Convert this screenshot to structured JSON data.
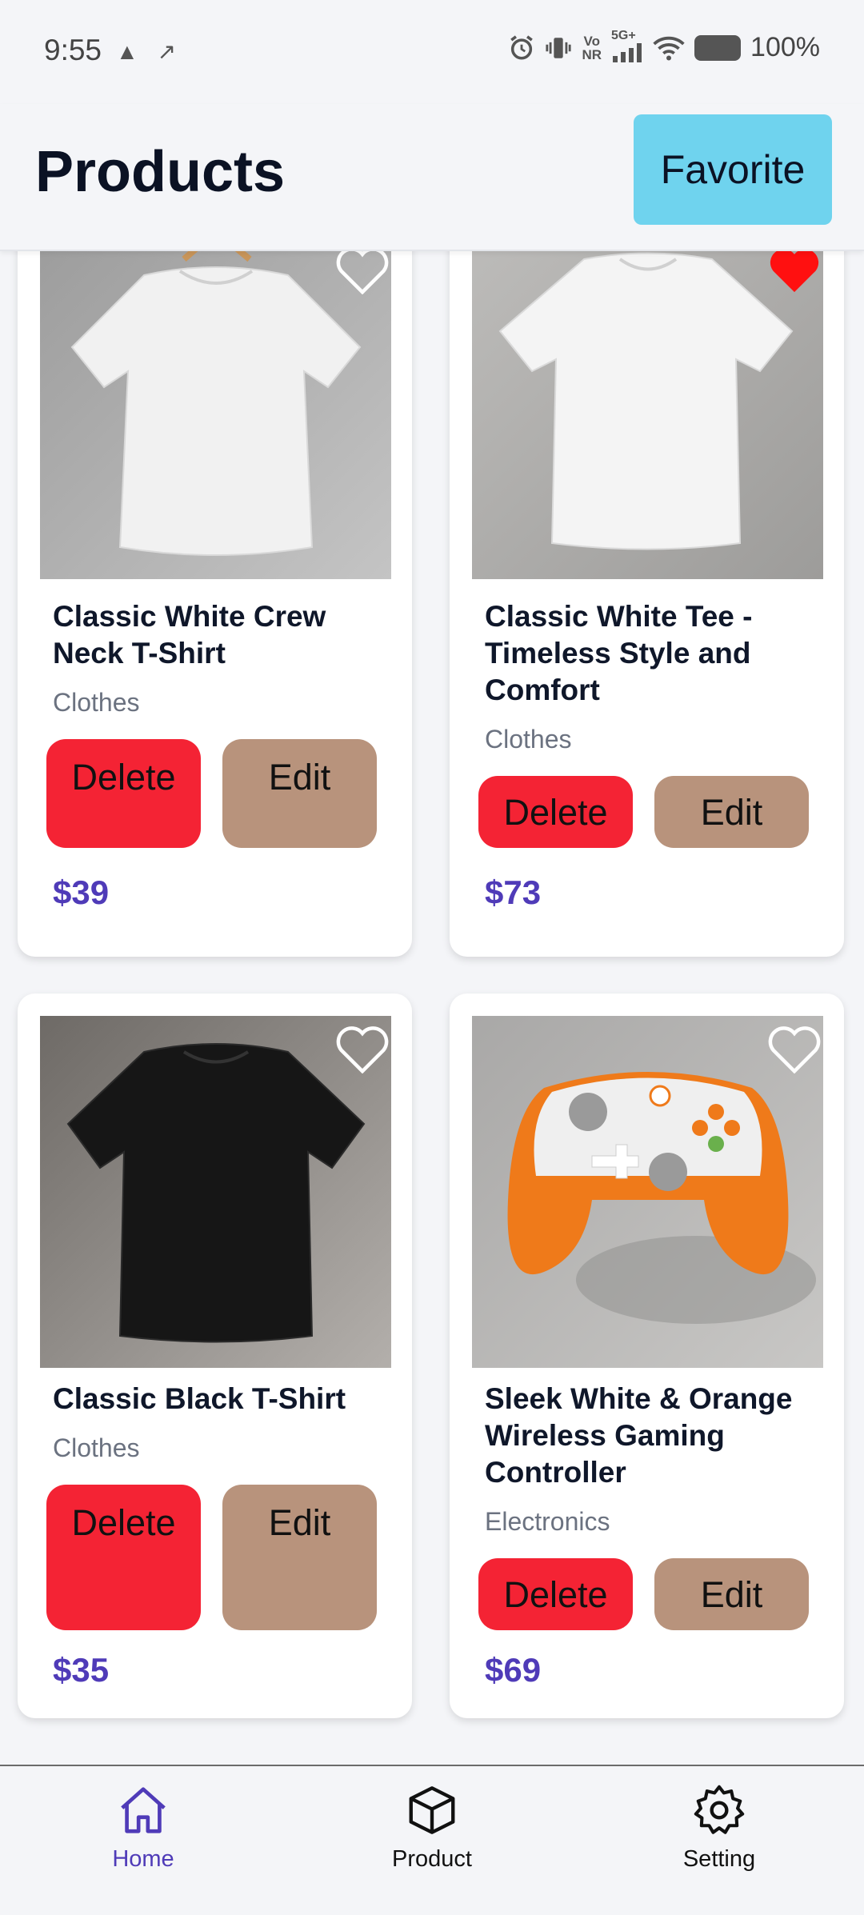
{
  "status_bar": {
    "time": "9:55",
    "left_icons": "▲ ↗",
    "network_top": "Vo",
    "network_bottom": "NR",
    "signal": "5G+",
    "battery": "100%"
  },
  "header": {
    "title": "Products",
    "favorite_label": "Favorite"
  },
  "products": [
    {
      "name": "Classic White Crew Neck T-Shirt",
      "category": "Clothes",
      "price": "$39",
      "favorited": false,
      "delete_label": "Delete",
      "edit_label": "Edit",
      "image": "white-tshirt-hanger"
    },
    {
      "name": "Classic White Tee - Timeless Style and Comfort",
      "category": "Clothes",
      "price": "$73",
      "favorited": true,
      "delete_label": "Delete",
      "edit_label": "Edit",
      "image": "white-tshirt-flat"
    },
    {
      "name": "Classic Black T-Shirt",
      "category": "Clothes",
      "price": "$35",
      "favorited": false,
      "delete_label": "Delete",
      "edit_label": "Edit",
      "image": "black-tshirt"
    },
    {
      "name": "Sleek White & Orange Wireless Gaming Controller",
      "category": "Electronics",
      "price": "$69",
      "favorited": false,
      "delete_label": "Delete",
      "edit_label": "Edit",
      "image": "gaming-controller"
    }
  ],
  "bottom_nav": {
    "home": "Home",
    "product": "Product",
    "setting": "Setting",
    "active": "home"
  },
  "colors": {
    "favorite_button": "#6fd3ee",
    "delete_button": "#f42334",
    "edit_button": "#b8937c",
    "price": "#4f3bb8",
    "active_nav": "#4f3bb8",
    "heart_active": "#ff1010"
  }
}
